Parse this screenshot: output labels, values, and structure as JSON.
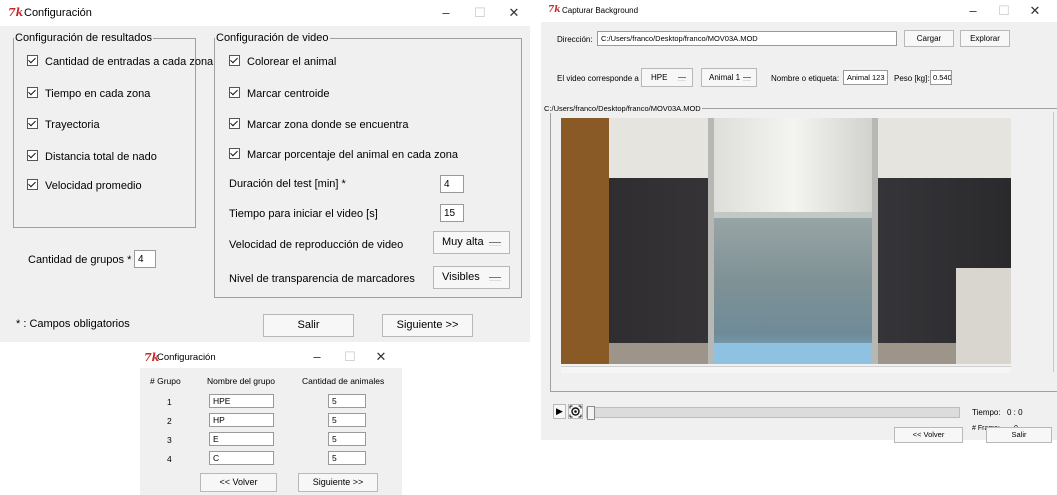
{
  "config_window": {
    "title": "Configuración",
    "logo": "7k",
    "results_group": {
      "legend": "Configuración de resultados",
      "options": [
        "Cantidad de entradas a cada zona",
        "Tiempo en cada zona",
        "Trayectoria",
        "Distancia total de nado",
        "Velocidad promedio"
      ]
    },
    "groups_label": "Cantidad de grupos *",
    "groups_value": "4",
    "required_note": "* : Campos obligatorios",
    "video_group": {
      "legend": "Configuración de video",
      "options": [
        "Colorear el animal",
        "Marcar centroide",
        "Marcar zona donde se encuentra",
        "Marcar porcentaje del animal en cada zona"
      ],
      "duration_label": "Duración del test [min] *",
      "duration_value": "4",
      "start_label": "Tiempo para iniciar el video [s]",
      "start_value": "15",
      "speed_label": "Velocidad de reproducción de video",
      "speed_value": "Muy alta",
      "transparency_label": "Nivel de transparencia de marcadores",
      "transparency_value": "Visibles"
    },
    "exit_button": "Salir",
    "next_button": "Siguiente  >>"
  },
  "groups_window": {
    "title": "Configuración",
    "logo": "7k",
    "headers": [
      "# Grupo",
      "Nombre del grupo",
      "Cantidad de animales"
    ],
    "rows": [
      {
        "num": "1",
        "name": "HPE",
        "count": "5"
      },
      {
        "num": "2",
        "name": "HP",
        "count": "5"
      },
      {
        "num": "3",
        "name": "E",
        "count": "5"
      },
      {
        "num": "4",
        "name": "C",
        "count": "5"
      }
    ],
    "back_button": "<<    Volver",
    "next_button": "Siguiente  >>"
  },
  "capture_window": {
    "title": "Capturar Background",
    "logo": "7k",
    "path_label": "Dirección:",
    "path_value": "C:/Users/franco/Desktop/franco/MOV03A.MOD",
    "load_button": "Cargar",
    "browse_button": "Explorar",
    "video_group_label": "El video corresponde a",
    "video_group_value": "HPE",
    "animal_value": "Animal 1",
    "tag_label": "Nombre o etiqueta:",
    "tag_value": "Animal 123",
    "weight_label": "Peso [kg]:",
    "weight_value": "0.540",
    "frame_legend": "C:/Users/franco/Desktop/franco/MOV03A.MOD",
    "time_label": "Tiempo:",
    "time_value": "0 : 0",
    "frame_label": "# Frame:",
    "frame_value": "0",
    "back_button": "<<   Volver",
    "exit_button": "Salir",
    "play_glyph": "▶"
  },
  "colors": {
    "window_bg": "#f0f0f0",
    "titlebar_bg": "#ffffff",
    "tk_logo": "#c62828",
    "button_border": "#b8b8b8"
  }
}
